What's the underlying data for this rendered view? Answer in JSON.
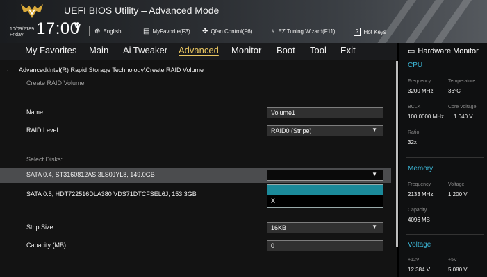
{
  "header": {
    "title": "UEFI BIOS Utility – Advanced Mode",
    "date": "10/09/2189",
    "day": "Friday",
    "time": "17:00",
    "items": [
      {
        "icon": "globe-icon",
        "label": "English"
      },
      {
        "icon": "favorite-icon",
        "label": "MyFavorite(F3)"
      },
      {
        "icon": "fan-icon",
        "label": "Qfan Control(F6)"
      },
      {
        "icon": "bulb-icon",
        "label": "EZ Tuning Wizard(F11)"
      },
      {
        "icon": "help-icon",
        "label": "Hot Keys"
      }
    ]
  },
  "menu": {
    "items": [
      "My Favorites",
      "Main",
      "Ai Tweaker",
      "Advanced",
      "Monitor",
      "Boot",
      "Tool",
      "Exit"
    ],
    "active": "Advanced"
  },
  "main": {
    "breadcrumb": "Advanced\\Intel(R) Rapid Storage Technology\\Create RAID Volume",
    "section_title": "Create RAID Volume",
    "name_label": "Name:",
    "name_value": "Volume1",
    "raid_level_label": "RAID Level:",
    "raid_level_value": "RAID0 (Stripe)",
    "select_disks_label": "Select Disks:",
    "disks": [
      {
        "label": "SATA 0.4, ST3160812AS 3LS0JYL8, 149.0GB",
        "value": ""
      },
      {
        "label": "SATA 0.5, HDT722516DLA380 VDS71DTCFSEL6J, 153.3GB",
        "value": ""
      }
    ],
    "dropdown_options": [
      "",
      "X"
    ],
    "strip_size_label": "Strip Size:",
    "strip_size_value": "16KB",
    "capacity_label": "Capacity (MB):",
    "capacity_value": "0"
  },
  "hw_monitor": {
    "title": "Hardware Monitor",
    "cpu": {
      "heading": "CPU",
      "frequency_label": "Frequency",
      "frequency_value": "3200 MHz",
      "temperature_label": "Temperature",
      "temperature_value": "36°C",
      "bclk_label": "BCLK",
      "bclk_value": "100.0000 MHz",
      "core_voltage_label": "Core Voltage",
      "core_voltage_value": "1.040 V",
      "ratio_label": "Ratio",
      "ratio_value": "32x"
    },
    "memory": {
      "heading": "Memory",
      "frequency_label": "Frequency",
      "frequency_value": "2133 MHz",
      "voltage_label": "Voltage",
      "voltage_value": "1.200 V",
      "capacity_label": "Capacity",
      "capacity_value": "4096 MB"
    },
    "voltage": {
      "heading": "Voltage",
      "v12_label": "+12V",
      "v12_value": "12.384 V",
      "v5_label": "+5V",
      "v5_value": "5.080 V"
    }
  },
  "colors": {
    "accent": "#e8c560",
    "section": "#3cb6d6",
    "selected_option": "#1b8a9a",
    "highlight_row": "#4b4c4e"
  }
}
